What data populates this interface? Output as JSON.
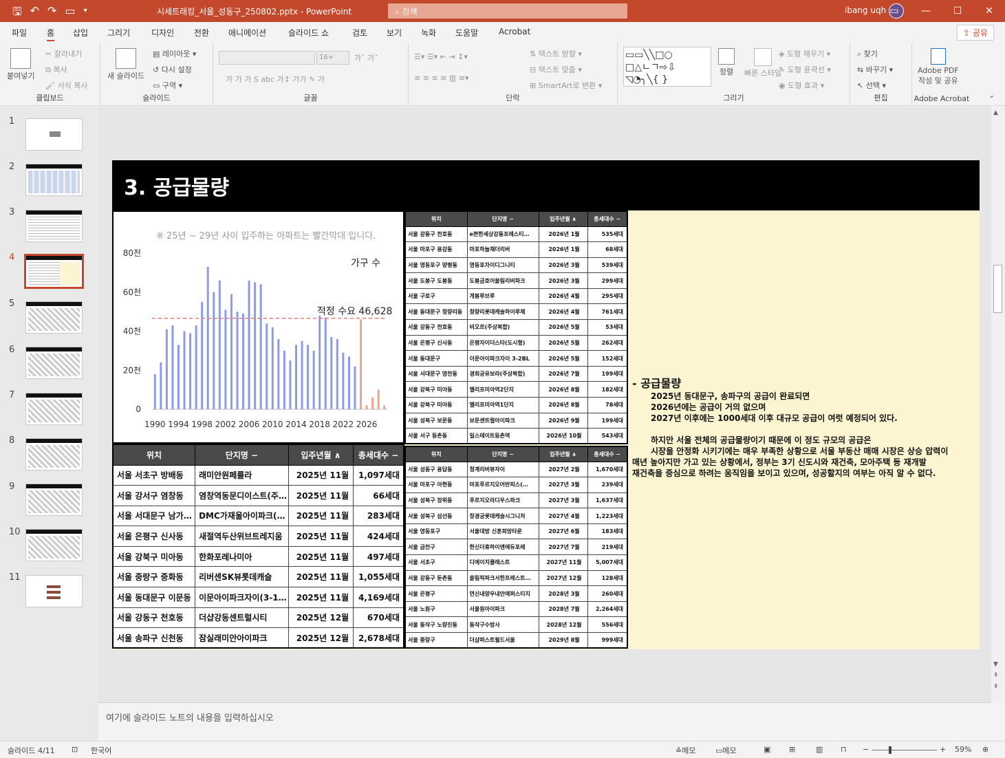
{
  "window": {
    "title": "시세트래킹_서울_성동구_250802.pptx  -  PowerPoint",
    "search_placeholder": "검색",
    "user": "ibang uqh"
  },
  "menu": {
    "tabs": [
      "파일",
      "홈",
      "삽입",
      "그리기",
      "디자인",
      "전환",
      "애니메이션",
      "슬라이드 쇼",
      "검토",
      "보기",
      "녹화",
      "도움말",
      "Acrobat"
    ],
    "active": "홈",
    "share": "공유"
  },
  "ribbon": {
    "clipboard": {
      "label": "클립보드",
      "paste": "붙여넣기",
      "cut": "잘라내기",
      "copy": "복사",
      "format_painter": "서식 복사"
    },
    "slides": {
      "label": "슬라이드",
      "new_slide": "새 슬라이드",
      "layout": "레이아웃",
      "reset": "다시 설정",
      "section": "구역"
    },
    "font": {
      "label": "글꼴",
      "size": "16+"
    },
    "paragraph": {
      "label": "단락",
      "text_direction": "텍스트 방향",
      "align_text": "텍스트 맞춤",
      "smartart": "SmartArt로 변환"
    },
    "drawing": {
      "label": "그리기",
      "arrange": "정렬",
      "quick_styles": "빠른 스타일",
      "shape_fill": "도형 채우기",
      "shape_outline": "도형 윤곽선",
      "shape_effects": "도형 효과"
    },
    "editing": {
      "label": "편집",
      "find": "찾기",
      "replace": "바꾸기",
      "select": "선택"
    },
    "acrobat": {
      "label": "Adobe Acrobat",
      "create_pdf": "Adobe PDF",
      "create_pdf2": "작성 및 공유"
    }
  },
  "thumbnails": [
    "1",
    "2",
    "3",
    "4",
    "5",
    "6",
    "7",
    "8",
    "9",
    "10",
    "11"
  ],
  "active_slide": 4,
  "slide": {
    "title": "3. 공급물량",
    "chart_note": "※ 25년 ~ 29년 사이 입주하는 아파트는 빨간막대 입니다.",
    "text": {
      "heading": "- 공급물량",
      "lines": [
        "2025년 동대문구, 송파구의 공급이 완료되면",
        "2026년에는 공급이 거의 없으며",
        "2027년 이후에는 1000세대  이후 대규모 공급이 여럿 예정되어 있다."
      ],
      "lines2": [
        "하지만 서울 전체의 공급물량이기 때문에 이 정도 규모의 공급은",
        "시장을 안정화 시키기에는 매우 부족한 상황으로 서울 부동산 매매 시장은 상승 압력이",
        "매년 높아지만 가고 있는 상황에서, 정부는 3기 신도시와 재건축, 모아주택 등 재개발",
        "재건축을 중심으로 하려는 움직임을 보이고 있으며, 성공할지의 여부는 아직 알 수 없다."
      ]
    }
  },
  "chart_data": {
    "type": "bar",
    "series": [
      {
        "name": "가구 수",
        "color": "#8e9be6"
      }
    ],
    "highlight_color": "#f2a38f",
    "x": [
      1990,
      1991,
      1992,
      1993,
      1994,
      1995,
      1996,
      1997,
      1998,
      1999,
      2000,
      2001,
      2002,
      2003,
      2004,
      2005,
      2006,
      2007,
      2008,
      2009,
      2010,
      2011,
      2012,
      2013,
      2014,
      2015,
      2016,
      2017,
      2018,
      2019,
      2020,
      2021,
      2022,
      2023,
      2024,
      2025,
      2026,
      2027,
      2028,
      2029
    ],
    "values": [
      18000,
      24000,
      41000,
      43000,
      33000,
      40000,
      39000,
      43000,
      55000,
      73000,
      60000,
      66000,
      51000,
      59000,
      50000,
      49000,
      66000,
      65000,
      64000,
      44000,
      42000,
      36000,
      30000,
      25000,
      33000,
      35000,
      33000,
      30000,
      48000,
      47000,
      37000,
      36000,
      29000,
      27000,
      22000,
      46000,
      2000,
      6000,
      10000,
      2000
    ],
    "highlight_years": [
      2025,
      2026,
      2027,
      2028,
      2029
    ],
    "reference_line": {
      "value": 46628,
      "label": "적정 수요 46,628",
      "color": "#f07a6f"
    },
    "ylim": [
      0,
      80000
    ],
    "y_ticks": [
      0,
      20000,
      40000,
      60000,
      80000
    ],
    "y_tick_labels": [
      "0",
      "20천",
      "40천",
      "60천",
      "80천"
    ],
    "x_tick_labels": [
      "1990",
      "1994",
      "1998",
      "2002",
      "2006",
      "2010",
      "2014",
      "2018",
      "2022",
      "2026"
    ],
    "grid": false,
    "legend": "top-right"
  },
  "big_table": {
    "headers": [
      "위치",
      "단지명",
      "입주년월",
      "총세대수"
    ],
    "rows": [
      [
        "서울 서초구 방배동",
        "래미안원페를라",
        "2025년 11월",
        "1,097세대"
      ],
      [
        "서울 강서구 염창동",
        "염창역동문디이스트(주…",
        "2025년 11월",
        "66세대"
      ],
      [
        "서울 서대문구 남가좌동",
        "DMC가재울아이파크(주…",
        "2025년 11월",
        "283세대"
      ],
      [
        "서울 은평구 신사동",
        "새절역두산위브트레지움",
        "2025년 11월",
        "424세대"
      ],
      [
        "서울 강북구 미아동",
        "한화포레나미아",
        "2025년 11월",
        "497세대"
      ],
      [
        "서울 중랑구 중화동",
        "리버센SK뷰롯데캐슬",
        "2025년 11월",
        "1,055세대"
      ],
      [
        "서울 동대문구 이문동",
        "이문아이파크자이(3-1BL)",
        "2025년 11월",
        "4,169세대"
      ],
      [
        "서울 강동구 천호동",
        "더샵강동센트럴시티",
        "2025년 12월",
        "670세대"
      ],
      [
        "서울 송파구 신천동",
        "잠실래미안아이파크",
        "2025년 12월",
        "2,678세대"
      ]
    ]
  },
  "small_table_top": {
    "headers": [
      "위치",
      "단지명",
      "입주년월",
      "총세대수"
    ],
    "rows": [
      [
        "서울 강동구 천호동",
        "e편한세상강동프레스티…",
        "2026년 1월",
        "535세대"
      ],
      [
        "서울 마포구 용강동",
        "마포하늘채더리버",
        "2026년 1월",
        "68세대"
      ],
      [
        "서울 영등포구 양평동",
        "영등포자이디그니티",
        "2026년 3월",
        "539세대"
      ],
      [
        "서울 도봉구 도봉동",
        "도봉금호어울림리버파크",
        "2026년 3월",
        "299세대"
      ],
      [
        "서울 구로구",
        "개봉루브루",
        "2026년 4월",
        "295세대"
      ],
      [
        "서울 동대문구 청량리동",
        "청량리롯데캐슬하이루체",
        "2026년 4월",
        "761세대"
      ],
      [
        "서울 강동구 천호동",
        "비오르(주상복합)",
        "2026년 5월",
        "53세대"
      ],
      [
        "서울 은평구 신사동",
        "은평자이더스타(도시형)",
        "2026년 5월",
        "262세대"
      ],
      [
        "서울 동대문구",
        "이문아이파크자이 3-2BL",
        "2026년 5월",
        "152세대"
      ],
      [
        "서울 서대문구 영천동",
        "경희궁유보라(주상복합)",
        "2026년 7월",
        "199세대"
      ],
      [
        "서울 강북구 미아동",
        "엘리프미아역2단지",
        "2026년 8월",
        "182세대"
      ],
      [
        "서울 강북구 미아동",
        "엘리프미아역1단지",
        "2026년 8월",
        "78세대"
      ],
      [
        "서울 성북구 보문동",
        "보문센트럴아이파크",
        "2026년 9월",
        "199세대"
      ],
      [
        "서울 서구 등촌동",
        "일스테이트등촌역",
        "2026년 10월",
        "543세대"
      ]
    ]
  },
  "small_table_bottom": {
    "headers": [
      "위치",
      "단지명",
      "입주년월",
      "총세대수"
    ],
    "rows": [
      [
        "서울 성동구 용답동",
        "청계리버뷰자이",
        "2027년 2월",
        "1,670세대"
      ],
      [
        "서울 마포구 아현동",
        "마포푸르지오어반피스(…",
        "2027년 3월",
        "239세대"
      ],
      [
        "서울 성북구 장위동",
        "푸르지오라디우스파크",
        "2027년 3월",
        "1,637세대"
      ],
      [
        "서울 성북구 삼선동",
        "창경궁롯데캐슬시그니처",
        "2027년 4월",
        "1,223세대"
      ],
      [
        "서울 영등포구",
        "서울대방 신혼희망타운",
        "2027년 6월",
        "183세대"
      ],
      [
        "서울 금천구",
        "한신더휴하이엔에듀포레",
        "2027년 7월",
        "219세대"
      ],
      [
        "서울 서초구",
        "디에이치클래스트",
        "2027년 11월",
        "5,007세대"
      ],
      [
        "서울 강동구 둔촌동",
        "올림픽파크서한프레스트…",
        "2027년 12월",
        "128세대"
      ],
      [
        "서울 은평구",
        "연신내양우내안에퍼스티지",
        "2028년 3월",
        "260세대"
      ],
      [
        "서울 노원구",
        "서울원아이파크",
        "2028년 7월",
        "2,264세대"
      ],
      [
        "서울 동작구 노량진동",
        "동작구수방사",
        "2028년 12월",
        "556세대"
      ],
      [
        "서울 중랑구",
        "더샵퍼스트월드서울",
        "2029년 8월",
        "999세대"
      ]
    ]
  },
  "notes_placeholder": "여기에 슬라이드 노트의 내용을 입력하십시오",
  "status": {
    "slide_counter": "슬라이드 4/11",
    "language": "한국어",
    "notes_button": "메모",
    "comments_button": "메모",
    "zoom": "59%"
  }
}
